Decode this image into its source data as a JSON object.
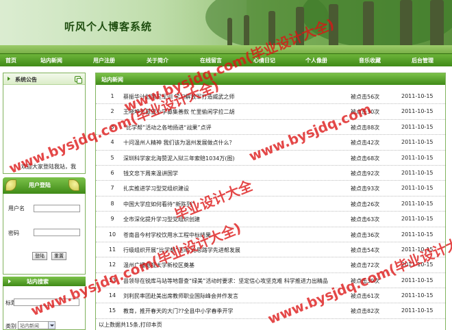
{
  "site": {
    "title": "听风个人博客系统"
  },
  "nav": [
    "首页",
    "站内新闻",
    "用户注册",
    "关于简介",
    "在线留言",
    "心情日记",
    "个人像册",
    "音乐收藏",
    "后台管理"
  ],
  "notice": {
    "title": "系统公告",
    "text": "欢迎大家登陆我站，我"
  },
  "login": {
    "title": "用户登陆",
    "username_label": "用户名",
    "password_label": "密码",
    "login_button": "登陆",
    "reset_button": "重置"
  },
  "search": {
    "title": "站内搜索",
    "keyword_label": "标题",
    "category_label": "类别",
    "category_value": "站内新闻"
  },
  "news": {
    "title": "站内新闻",
    "rows": [
      {
        "num": "1",
        "title": "蔡振华计划国足军训  学习解放军打造威武之师",
        "hits": "被点击56次",
        "date": "2011-10-15"
      },
      {
        "num": "2",
        "title": "王晓坤方募望小学募集善款  忙里偷闲学拉二胡",
        "hits": "被点击30次",
        "date": "2011-10-15"
      },
      {
        "num": "3",
        "title": "“比学帮”活动之各地扬进“战果”点评",
        "hits": "被点击88次",
        "date": "2011-10-15"
      },
      {
        "num": "4",
        "title": "十问温州人精神  我们该为温州发展做点什么？",
        "hits": "被点击42次",
        "date": "2011-10-15"
      },
      {
        "num": "5",
        "title": "深圳科学家北海赞泥入狱三年索赔1034万(图)",
        "hits": "被点击68次",
        "date": "2011-10-15"
      },
      {
        "num": "6",
        "title": "钱文忠下周来温讲国学",
        "hits": "被点击92次",
        "date": "2011-10-15"
      },
      {
        "num": "7",
        "title": "扎实推进学习型党组织建设",
        "hits": "被点击93次",
        "date": "2011-10-15"
      },
      {
        "num": "8",
        "title": "中国大学应如何看待“新陈列”",
        "hits": "被点击26次",
        "date": "2011-10-15"
      },
      {
        "num": "9",
        "title": "全市深化提升学习型党组织创建",
        "hits": "被点击63次",
        "date": "2011-10-15"
      },
      {
        "num": "10",
        "title": "苍南县今村学校饮用水工程中标结果",
        "hits": "被点击36次",
        "date": "2011-10-15"
      },
      {
        "num": "11",
        "title": "行级组织开展“比学帮”活动  比思路学先进帮发展",
        "hits": "被点击54次",
        "date": "2011-10-15"
      },
      {
        "num": "12",
        "title": "温州广播电视大学新校区奠基",
        "hits": "被点击72次",
        "date": "2011-10-15"
      },
      {
        "num": "13",
        "title": "县领导在锐库马站等地督查“绿美”活动时要求：坚定信心攻坚克难 科学推进力出精品",
        "hits": "被点击39次",
        "date": "2011-10-15"
      },
      {
        "num": "14",
        "title": "刘利民率团赴美出席教师职业国际峰会并作发言",
        "hits": "被点击61次",
        "date": "2011-10-15"
      },
      {
        "num": "15",
        "title": "教育，推开春天的大门??全县中小学春季开学",
        "hits": "被点击82次",
        "date": "2011-10-15"
      }
    ],
    "footer": "以上数据共15条,打印本页"
  },
  "watermarks": [
    "www.bysjdq.com(毕业设计大全)",
    "www.bysjdq.com(毕业设计大全)",
    "www.bysjdq.com",
    "www.bysjdq.com(毕业设计大全)",
    "www.bysjdq.com(毕业设计大全)",
    "毕业设计大全"
  ]
}
